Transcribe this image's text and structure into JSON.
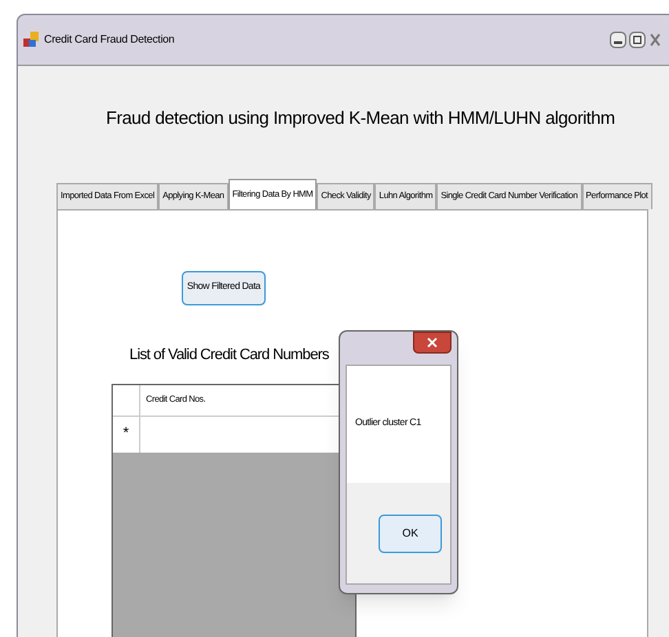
{
  "window": {
    "title": "Credit Card Fraud Detection"
  },
  "heading": "Fraud detection using Improved K-Mean with HMM/LUHN algorithm",
  "tabs": [
    {
      "label": "Imported Data From Excel",
      "selected": false
    },
    {
      "label": "Applying K-Mean",
      "selected": false
    },
    {
      "label": "Filtering Data By HMM",
      "selected": true
    },
    {
      "label": "Check Validity",
      "selected": false
    },
    {
      "label": "Luhn Algorithm",
      "selected": false
    },
    {
      "label": "Single Credit Card Number Verification",
      "selected": false
    },
    {
      "label": "Performance Plot",
      "selected": false
    }
  ],
  "show_button": "Show Filtered Data",
  "list_label": "List of Valid Credit Card Numbers",
  "grid": {
    "columns": [
      "Credit Card Nos."
    ],
    "new_row_marker": "*"
  },
  "dialog": {
    "message": "Outlier cluster C1",
    "button": "OK"
  }
}
